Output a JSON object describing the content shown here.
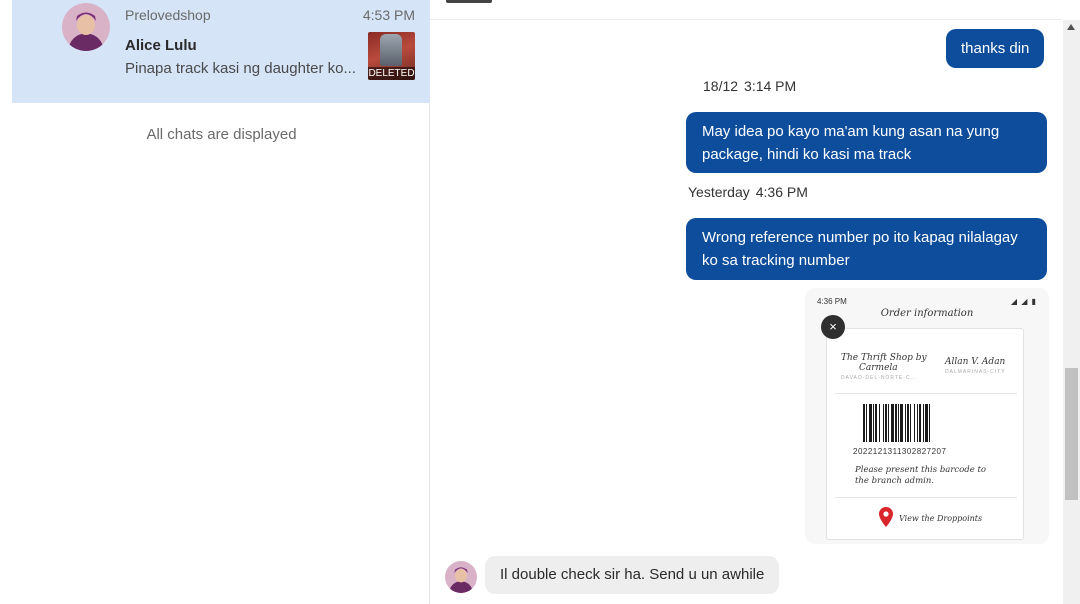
{
  "chat_list": {
    "item": {
      "shop": "Prelovedshop",
      "time": "4:53 PM",
      "name": "Alice Lulu",
      "preview": "Pinapa track kasi ng daughter ko...",
      "thumb_badge": "DELETED"
    },
    "footer": "All chats are displayed"
  },
  "conversation": {
    "messages": [
      {
        "text": "thanks din"
      },
      {
        "text": "May idea po kayo ma'am kung asan na yung package, hindi ko kasi ma track"
      },
      {
        "text": "Wrong reference number po ito kapag nilalagay ko sa tracking number"
      },
      {
        "text": "Il double check sir ha. Send u un awhile"
      }
    ],
    "timestamps": [
      {
        "date": "18/12",
        "time": "3:14 PM"
      },
      {
        "date": "Yesterday",
        "time": "4:36 PM"
      }
    ],
    "attachment": {
      "status_time": "4:36 PM",
      "status_icons": "◢ ◢ ▮",
      "title": "Order information",
      "close_symbol": "×",
      "sender_line1": "The Thrift Shop by",
      "sender_line2": "Carmela",
      "receiver": "Allan V. Adan",
      "sender_sub": "DAVAO-DEL-NORTE-C...",
      "receiver_sub": "DALMARINAS-CITY",
      "barcode_number": "2022121311302827207",
      "note_line1": "Please present this barcode to",
      "note_line2": "the branch admin.",
      "link": "View the Droppoints",
      "pin_color": "#d8262c"
    }
  },
  "colors": {
    "outgoing_bubble": "#0d4d9c",
    "incoming_bubble": "#eeeeee",
    "selected_chat": "#d5e4f7"
  }
}
